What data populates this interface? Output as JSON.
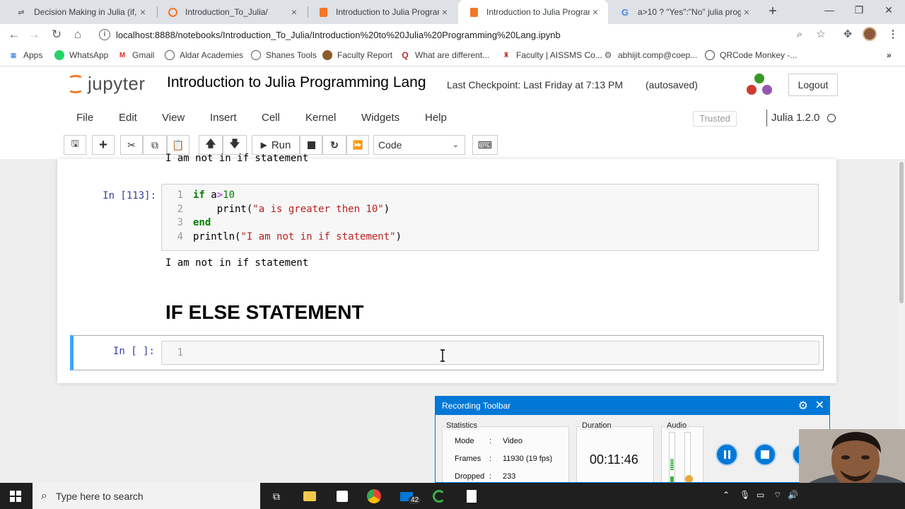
{
  "browser": {
    "tabs": [
      {
        "title": "Decision Making in Julia (if, if-el",
        "active": false
      },
      {
        "title": "Introduction_To_Julia/",
        "active": false
      },
      {
        "title": "Introduction to Julia Programm",
        "active": false
      },
      {
        "title": "Introduction to Julia Programm",
        "active": true
      },
      {
        "title": "a>10 ? \"Yes\":\"No\" julia progra",
        "active": false
      }
    ],
    "url": "localhost:8888/notebooks/Introduction_To_Julia/Introduction%20to%20Julia%20Programming%20Lang.ipynb",
    "bookmarks": [
      "Apps",
      "WhatsApp",
      "Gmail",
      "Aldar Academies",
      "Shanes Tools",
      "Faculty Report",
      "What are different...",
      "Faculty | AISSMS Co...",
      "abhijit.comp@coep...",
      "QRCode Monkey -..."
    ]
  },
  "jupyter": {
    "logo_text": "jupyter",
    "notebook_title": "Introduction to Julia Programming Lang",
    "checkpoint": "Last Checkpoint: Last Friday at 7:13 PM",
    "autosave": "(autosaved)",
    "logout": "Logout",
    "menu": [
      "File",
      "Edit",
      "View",
      "Insert",
      "Cell",
      "Kernel",
      "Widgets",
      "Help"
    ],
    "trusted": "Trusted",
    "kernel": "Julia 1.2.0",
    "toolbar": {
      "run": "Run",
      "cell_type": "Code"
    }
  },
  "notebook": {
    "prev_output": "I am not in if statement",
    "cell": {
      "prompt": "In [113]:",
      "line_numbers": [
        "1",
        "2",
        "3",
        "4"
      ],
      "output": "I am not in if statement"
    },
    "markdown_heading": "IF ELSE STATEMENT",
    "empty_cell": {
      "prompt": "In [ ]:",
      "line_number": "1"
    }
  },
  "recording": {
    "title": "Recording Toolbar",
    "statistics_label": "Statistics",
    "stats": [
      {
        "label": "Mode",
        "sep": ":",
        "value": "Video"
      },
      {
        "label": "Frames",
        "sep": ":",
        "value": "11930 (19 fps)"
      },
      {
        "label": "Dropped",
        "sep": ":",
        "value": "233"
      }
    ],
    "duration_label": "Duration",
    "duration": "00:11:46",
    "audio_label": "Audio"
  },
  "taskbar": {
    "search_placeholder": "Type here to search",
    "mail_badge": "42"
  }
}
